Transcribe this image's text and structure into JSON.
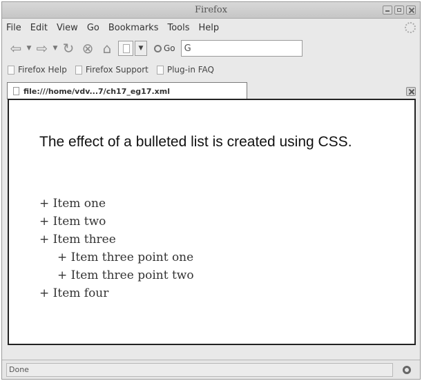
{
  "window": {
    "title": "Firefox"
  },
  "menu": [
    "File",
    "Edit",
    "View",
    "Go",
    "Bookmarks",
    "Tools",
    "Help"
  ],
  "navbar": {
    "go_label": "Go",
    "search_value": "G"
  },
  "bookmarks": [
    "Firefox Help",
    "Firefox Support",
    "Plug-in FAQ"
  ],
  "tab": {
    "label": "file:///home/vdv...7/ch17_eg17.xml"
  },
  "content": {
    "heading": "The effect of a bulleted list is created using CSS.",
    "items": [
      "+ Item one",
      "+ Item two",
      "+ Item three",
      "+ Item three point one",
      "+ Item three point two",
      "+ Item four"
    ]
  },
  "status": {
    "text": "Done"
  }
}
